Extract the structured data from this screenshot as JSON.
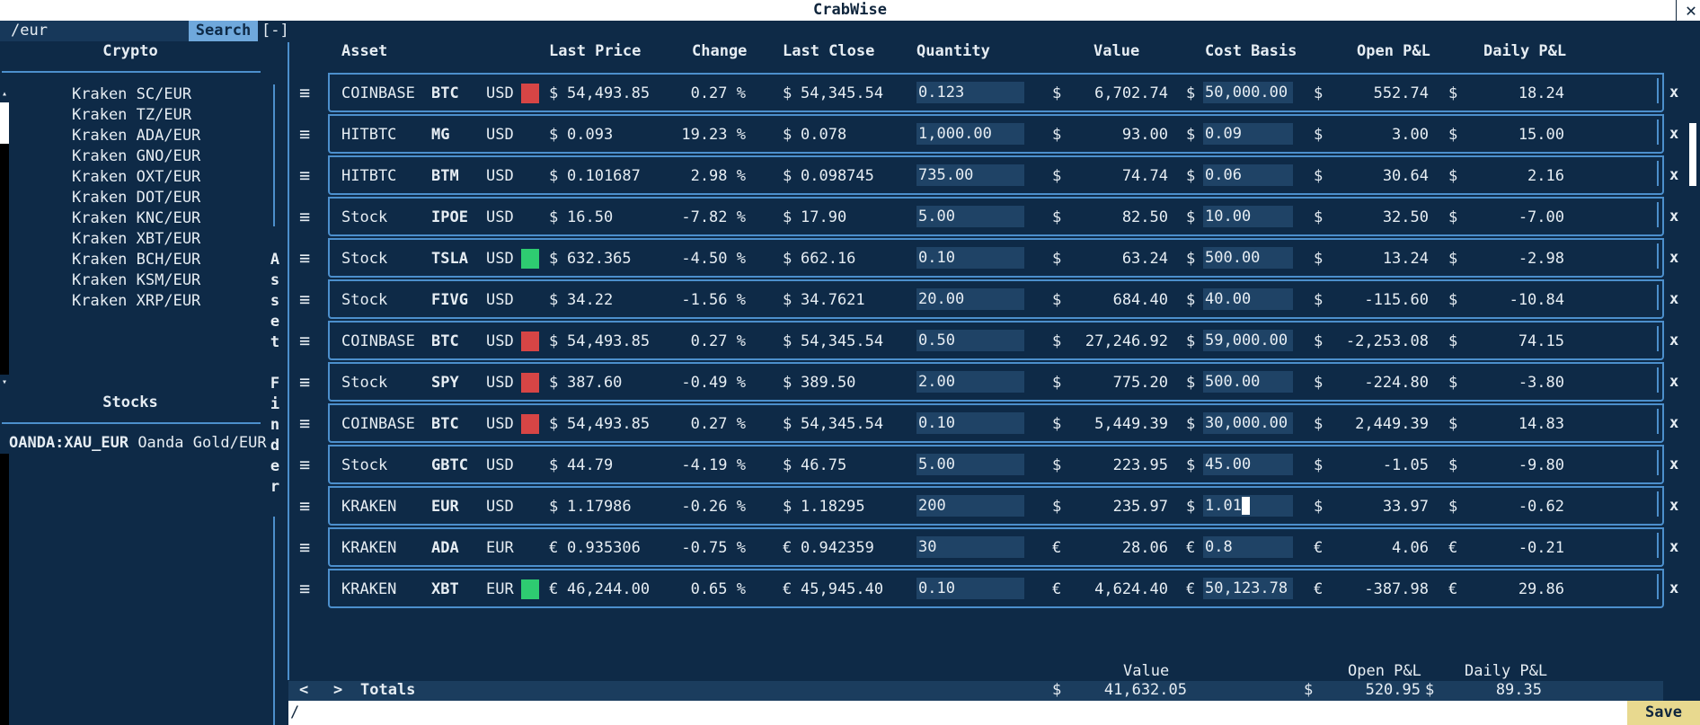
{
  "app": {
    "title": "CrabWise",
    "close_label": "✕"
  },
  "search": {
    "value": "/eur",
    "button_label": "Search",
    "collapse_label": "[-]"
  },
  "sidebar": {
    "crypto_title": "Crypto",
    "crypto_items": [
      "Kraken SC/EUR",
      "Kraken TZ/EUR",
      "Kraken ADA/EUR",
      "Kraken GNO/EUR",
      "Kraken OXT/EUR",
      "Kraken DOT/EUR",
      "Kraken KNC/EUR",
      "Kraken XBT/EUR",
      "Kraken BCH/EUR",
      "Kraken KSM/EUR",
      "Kraken XRP/EUR"
    ],
    "stocks_title": "Stocks",
    "stock_items": [
      {
        "symbol": "OANDA:XAU_EUR",
        "name": "Oanda Gold/EUR"
      }
    ],
    "scroll_up": "▴",
    "scroll_down": "▾"
  },
  "asset_finder_label": "Asset Finder",
  "table": {
    "headers": {
      "asset": "Asset",
      "last_price": "Last Price",
      "change": "Change",
      "last_close": "Last Close",
      "quantity": "Quantity",
      "value": "Value",
      "cost_basis": "Cost Basis",
      "open_pnl": "Open P&L",
      "daily_pnl": "Daily P&L"
    },
    "menu_icon": "≡",
    "remove_label": "x",
    "rows": [
      {
        "exchange": "COINBASE",
        "symbol": "BTC",
        "currency": "USD",
        "swatch": "red",
        "sym": "$",
        "last_price": "54,493.85",
        "change": "0.27 %",
        "last_close": "54,345.54",
        "quantity": "0.123",
        "value": "6,702.74",
        "cost_basis": "50,000.00",
        "open_pnl": "552.74",
        "daily_pnl": "18.24"
      },
      {
        "exchange": "HITBTC",
        "symbol": "MG",
        "currency": "USD",
        "swatch": "",
        "sym": "$",
        "last_price": "0.093",
        "change": "19.23 %",
        "last_close": "0.078",
        "quantity": "1,000.00",
        "value": "93.00",
        "cost_basis": "0.09",
        "open_pnl": "3.00",
        "daily_pnl": "15.00"
      },
      {
        "exchange": "HITBTC",
        "symbol": "BTM",
        "currency": "USD",
        "swatch": "",
        "sym": "$",
        "last_price": "0.101687",
        "change": "2.98 %",
        "last_close": "0.098745",
        "quantity": "735.00",
        "value": "74.74",
        "cost_basis": "0.06",
        "open_pnl": "30.64",
        "daily_pnl": "2.16"
      },
      {
        "exchange": "Stock",
        "symbol": "IPOE",
        "currency": "USD",
        "swatch": "",
        "sym": "$",
        "last_price": "16.50",
        "change": "-7.82 %",
        "last_close": "17.90",
        "quantity": "5.00",
        "value": "82.50",
        "cost_basis": "10.00",
        "open_pnl": "32.50",
        "daily_pnl": "-7.00"
      },
      {
        "exchange": "Stock",
        "symbol": "TSLA",
        "currency": "USD",
        "swatch": "green",
        "sym": "$",
        "last_price": "632.365",
        "change": "-4.50 %",
        "last_close": "662.16",
        "quantity": "0.10",
        "value": "63.24",
        "cost_basis": "500.00",
        "open_pnl": "13.24",
        "daily_pnl": "-2.98"
      },
      {
        "exchange": "Stock",
        "symbol": "FIVG",
        "currency": "USD",
        "swatch": "",
        "sym": "$",
        "last_price": "34.22",
        "change": "-1.56 %",
        "last_close": "34.7621",
        "quantity": "20.00",
        "value": "684.40",
        "cost_basis": "40.00",
        "open_pnl": "-115.60",
        "daily_pnl": "-10.84"
      },
      {
        "exchange": "COINBASE",
        "symbol": "BTC",
        "currency": "USD",
        "swatch": "red",
        "sym": "$",
        "last_price": "54,493.85",
        "change": "0.27 %",
        "last_close": "54,345.54",
        "quantity": "0.50",
        "value": "27,246.92",
        "cost_basis": "59,000.00",
        "open_pnl": "-2,253.08",
        "daily_pnl": "74.15"
      },
      {
        "exchange": "Stock",
        "symbol": "SPY",
        "currency": "USD",
        "swatch": "red",
        "sym": "$",
        "last_price": "387.60",
        "change": "-0.49 %",
        "last_close": "389.50",
        "quantity": "2.00",
        "value": "775.20",
        "cost_basis": "500.00",
        "open_pnl": "-224.80",
        "daily_pnl": "-3.80"
      },
      {
        "exchange": "COINBASE",
        "symbol": "BTC",
        "currency": "USD",
        "swatch": "red",
        "sym": "$",
        "last_price": "54,493.85",
        "change": "0.27 %",
        "last_close": "54,345.54",
        "quantity": "0.10",
        "value": "5,449.39",
        "cost_basis": "30,000.00",
        "open_pnl": "2,449.39",
        "daily_pnl": "14.83"
      },
      {
        "exchange": "Stock",
        "symbol": "GBTC",
        "currency": "USD",
        "swatch": "",
        "sym": "$",
        "last_price": "44.79",
        "change": "-4.19 %",
        "last_close": "46.75",
        "quantity": "5.00",
        "value": "223.95",
        "cost_basis": "45.00",
        "open_pnl": "-1.05",
        "daily_pnl": "-9.80"
      },
      {
        "exchange": "KRAKEN",
        "symbol": "EUR",
        "currency": "USD",
        "swatch": "",
        "sym": "$",
        "last_price": "1.17986",
        "change": "-0.26 %",
        "last_close": "1.18295",
        "quantity": "200",
        "value": "235.97",
        "cost_basis": "1.01",
        "open_pnl": "33.97",
        "daily_pnl": "-0.62",
        "editing": true
      },
      {
        "exchange": "KRAKEN",
        "symbol": "ADA",
        "currency": "EUR",
        "swatch": "",
        "sym": "€",
        "last_price": "0.935306",
        "change": "-0.75 %",
        "last_close": "0.942359",
        "quantity": "30",
        "value": "28.06",
        "cost_basis": "0.8",
        "open_pnl": "4.06",
        "daily_pnl": "-0.21"
      },
      {
        "exchange": "KRAKEN",
        "symbol": "XBT",
        "currency": "EUR",
        "swatch": "green",
        "sym": "€",
        "last_price": "46,244.00",
        "change": "0.65 %",
        "last_close": "45,945.40",
        "quantity": "0.10",
        "value": "4,624.40",
        "cost_basis": "50,123.78",
        "open_pnl": "-387.98",
        "daily_pnl": "29.86"
      }
    ]
  },
  "totals": {
    "value_header": "Value",
    "open_header": "Open P&L",
    "daily_header": "Daily P&L",
    "prev_label": "<",
    "next_label": ">",
    "label": "Totals",
    "currency_symbol": "$",
    "value": "41,632.05",
    "open_pnl": "520.95",
    "daily_pnl": "89.35"
  },
  "command": {
    "value": "/"
  },
  "save_label": "Save",
  "colors": {
    "background": "#0e2a47",
    "border": "#4c8fcc",
    "swatch_red": "#d64545",
    "swatch_green": "#2ecc71",
    "search_button": "#6fa8dc",
    "save_button": "#e8d98f"
  }
}
